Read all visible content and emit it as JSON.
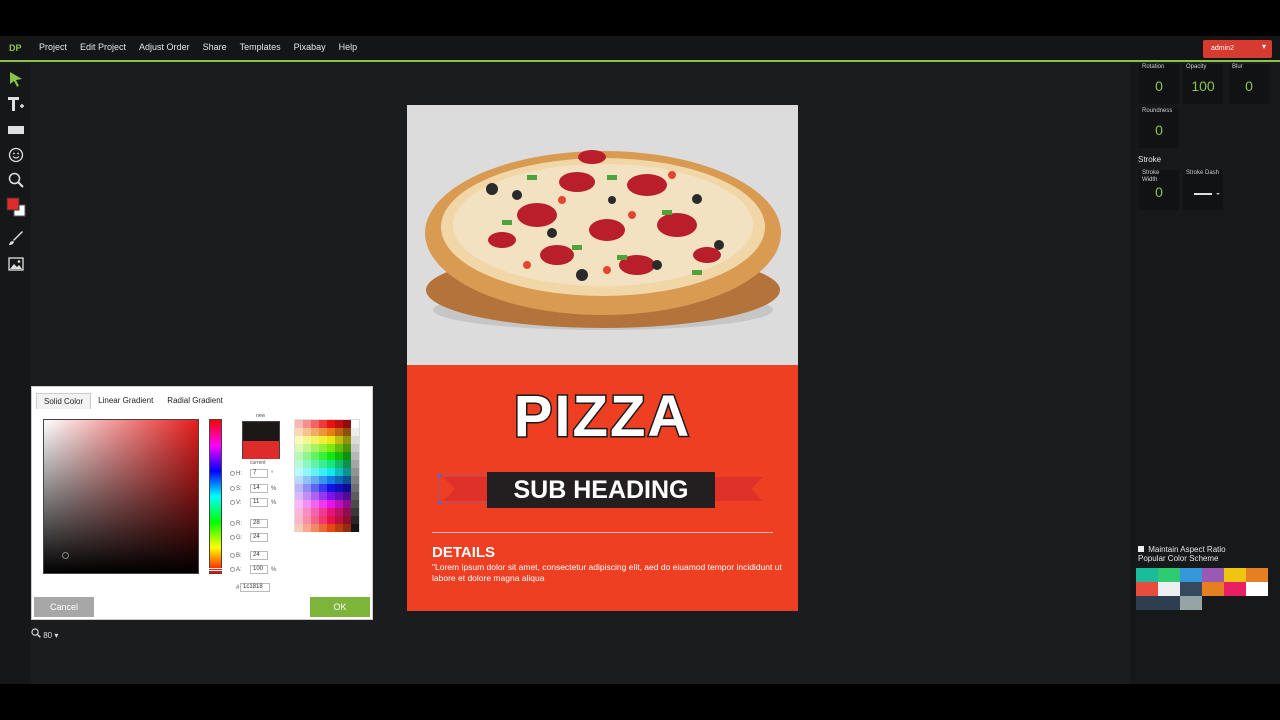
{
  "app": {
    "logo": "DP",
    "menu": [
      "Project",
      "Edit Project",
      "Adjust Order",
      "Share",
      "Templates",
      "Pixabay",
      "Help"
    ],
    "user": "admin2"
  },
  "toolbar": {
    "tools": [
      "pointer-icon",
      "text-add-icon",
      "rectangle-icon",
      "emoji-icon",
      "zoom-icon",
      "color-icon",
      "brush-icon",
      "image-icon"
    ]
  },
  "poster": {
    "title": "PIZZA",
    "subheading": "SUB HEADING",
    "details_heading": "DETAILS",
    "details_text": "\"Lorem ipsum dolor sit amet, consectetur adipiscing elit, aed do eiuamod tempor incididunt ut labore et dolore magna aliqua",
    "background_color": "#ef3f23"
  },
  "properties": {
    "rotation_label": "Rotation",
    "rotation": "0",
    "opacity_label": "Opacity",
    "opacity": "100",
    "blur_label": "Blur",
    "blur": "0",
    "roundness_label": "Roundness",
    "roundness": "0",
    "stroke_title": "Stroke",
    "stroke_width_label": "Stroke Width",
    "stroke_width": "0",
    "stroke_dash_label": "Stroke Dash",
    "maintain_aspect": "Maintain Aspect Ratio",
    "popular_scheme": "Popular Color Scheme",
    "swatches": [
      "#1abc9c",
      "#2ecc71",
      "#3498db",
      "#9b59b6",
      "#f1c40f",
      "#e67e22",
      "#e74c3c",
      "#ecf0f1",
      "#34495e",
      "#e67e22",
      "#e91e63",
      "#ffffff",
      "#2c3e50",
      "#2c3e50",
      "#95a5a6"
    ]
  },
  "color_picker": {
    "tabs": [
      "Solid Color",
      "Linear Gradient",
      "Radial Gradient"
    ],
    "new_label": "new",
    "current_label": "current",
    "h": "7",
    "s": "14",
    "v": "11",
    "r": "28",
    "g": "24",
    "b": "24",
    "a": "100",
    "hex": "1c1818",
    "cancel": "Cancel",
    "ok": "OK"
  },
  "zoom": "80"
}
